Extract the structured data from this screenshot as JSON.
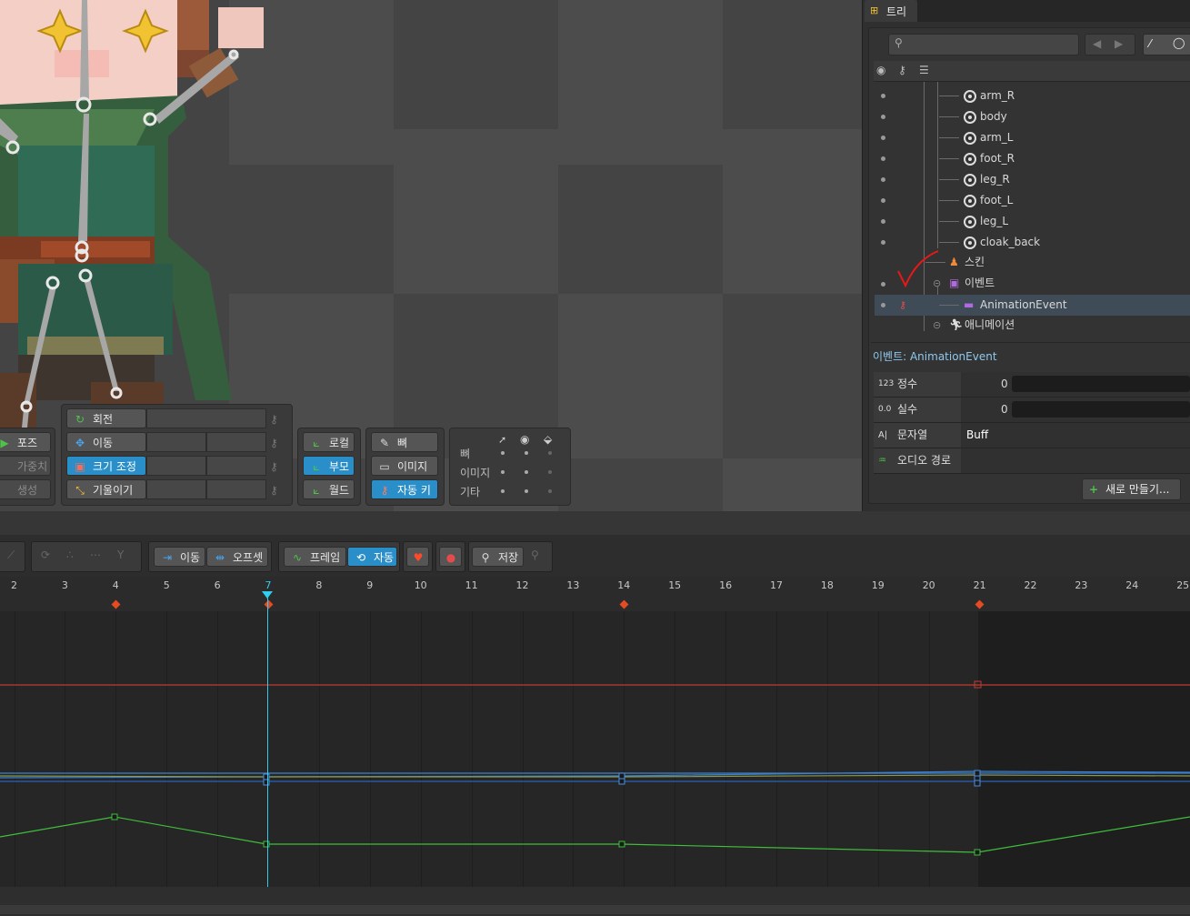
{
  "tool_panels": {
    "transform": [
      {
        "label": "회전",
        "icon": "rotate-icon",
        "active": false
      },
      {
        "label": "이동",
        "icon": "move-icon",
        "active": false
      },
      {
        "label": "크기 조정",
        "icon": "scale-icon",
        "active": true
      },
      {
        "label": "기울이기",
        "icon": "shear-icon",
        "active": false
      }
    ],
    "mode": [
      {
        "label": "포즈",
        "icon": "pose-icon",
        "active": false
      },
      {
        "label": "가중치",
        "icon": "weights-icon",
        "active": false
      },
      {
        "label": "생성",
        "icon": "create-icon",
        "active": false
      }
    ],
    "axes": [
      {
        "label": "로컬",
        "icon": "local-axes-icon",
        "active": false
      },
      {
        "label": "부모",
        "icon": "parent-axes-icon",
        "active": true
      },
      {
        "label": "월드",
        "icon": "world-axes-icon",
        "active": false
      }
    ],
    "compensate": [
      {
        "label": "뼈",
        "icon": "bone-icon",
        "active": false
      },
      {
        "label": "이미지",
        "icon": "image-icon",
        "active": false
      },
      {
        "label": "자동 키",
        "icon": "auto-key-icon",
        "active": true
      }
    ],
    "visibility": {
      "rows": [
        "뼈",
        "이미지",
        "기타"
      ]
    }
  },
  "tree": {
    "tab_label": "트리",
    "items": [
      {
        "label": "arm_R",
        "type": "bone"
      },
      {
        "label": "body",
        "type": "bone"
      },
      {
        "label": "arm_L",
        "type": "bone"
      },
      {
        "label": "foot_R",
        "type": "bone"
      },
      {
        "label": "leg_R",
        "type": "bone"
      },
      {
        "label": "foot_L",
        "type": "bone"
      },
      {
        "label": "leg_L",
        "type": "bone"
      },
      {
        "label": "cloak_back",
        "type": "bone"
      },
      {
        "label": "스킨",
        "type": "skins"
      },
      {
        "label": "이벤트",
        "type": "events"
      },
      {
        "label": "AnimationEvent",
        "type": "event"
      },
      {
        "label": "애니메이션",
        "type": "animations"
      }
    ],
    "selected_caption": "이벤트: AnimationEvent"
  },
  "properties": {
    "rows": [
      {
        "label": "정수",
        "value": "0",
        "icon": "int-icon"
      },
      {
        "label": "실수",
        "value": "0",
        "icon": "float-icon"
      },
      {
        "label": "문자열",
        "value": "Buff",
        "icon": "string-icon"
      },
      {
        "label": "오디오 경로",
        "value": "",
        "icon": "audio-icon"
      }
    ],
    "new_button": "새로 만들기..."
  },
  "timeline": {
    "toolbar": {
      "move_label": "이동",
      "offset_label": "오프셋",
      "frame_label": "프레임",
      "auto_label": "자동",
      "save_label": "저장"
    },
    "frame_labels": [
      "2",
      "3",
      "4",
      "5",
      "6",
      "7",
      "8",
      "9",
      "10",
      "11",
      "12",
      "13",
      "14",
      "15",
      "16",
      "17",
      "18",
      "19",
      "20",
      "21",
      "22",
      "23",
      "24",
      "25"
    ],
    "current_frame": 7,
    "keyframes": [
      4,
      7,
      14,
      21
    ]
  },
  "colors": {
    "accent": "#2a8fc9",
    "keyframe": "#e54b23",
    "playhead": "#2fd0ee",
    "curve_red": "#c43a32",
    "curve_green": "#3fbf3a",
    "curve_blue": "#3a7fd0",
    "annotation": "#e81818"
  }
}
